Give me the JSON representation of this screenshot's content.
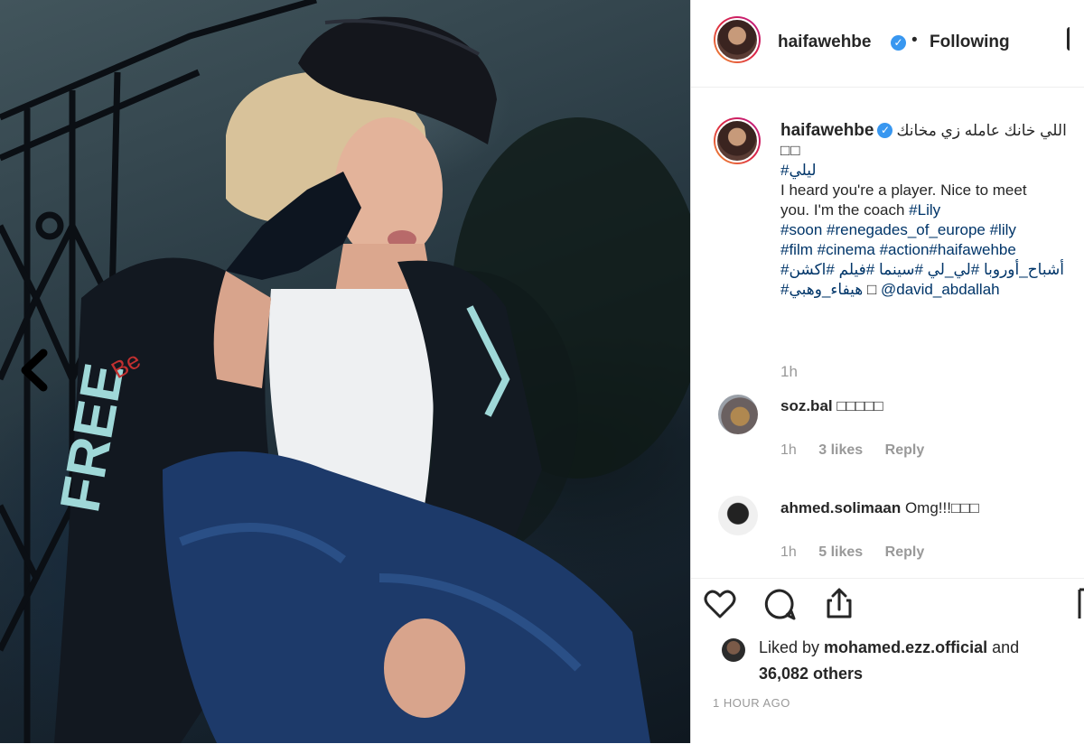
{
  "post": {
    "username": "haifawehbe",
    "follow_status": "Following",
    "separator": "•",
    "verified_mark": "✓"
  },
  "caption": {
    "username": "haifawehbe",
    "line1_ar": "اللي خانك عامله زي مخانك",
    "line2_boxes": "□□",
    "line3_ar": "#ليلي",
    "line4": "I heard you're a player. Nice to meet",
    "line5_text": "you. I'm the coach ",
    "line5_tag": "#Lily",
    "line6": "#soon #renegades_of_europe #lily",
    "line7": "#film #cinema #action#haifawehbe",
    "line8_ar": "#أشباح_أوروبا #لي_لي #سينما #فيلم #اكشن",
    "line9_ar": "#هيفاء_وهبي",
    "line9_box": " □ ",
    "line9_mention": "@david_abdallah",
    "time": "1h"
  },
  "comments": [
    {
      "username": "soz.bal",
      "text": "□□□□□",
      "time": "1h",
      "likes": "3 likes",
      "reply": "Reply"
    },
    {
      "username": "ahmed.solimaan",
      "text": "Omg!!!□□□",
      "time": "1h",
      "likes": "5 likes",
      "reply": "Reply"
    }
  ],
  "likes": {
    "prefix": "Liked by ",
    "user": "mohamed.ezz.official",
    "and": " and",
    "others": "36,082 others"
  },
  "timestamp": "1 HOUR AGO",
  "icons": {
    "nav": "chevron-left-icon",
    "like": "heart-icon",
    "comment": "comment-bubble-icon",
    "share": "share-icon",
    "save": "bookmark-icon"
  }
}
